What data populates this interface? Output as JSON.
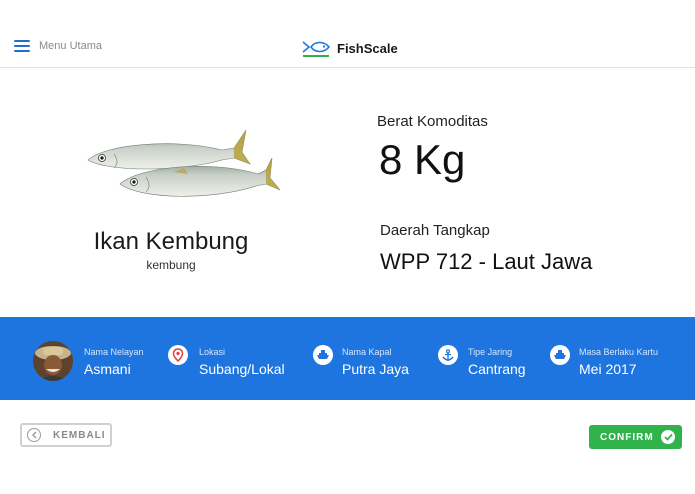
{
  "header": {
    "menu_label": "Menu Utama",
    "brand_name": "FishScale"
  },
  "commodity": {
    "species_name": "Ikan Kembung",
    "species_local_name": "kembung",
    "weight_label": "Berat Komoditas",
    "weight_value": "8 Kg",
    "area_label": "Daerah Tangkap",
    "area_value": "WPP 712 - Laut Jawa"
  },
  "info_bar": {
    "fisherman": {
      "label": "Nama Nelayan",
      "value": "Asmani"
    },
    "location": {
      "label": "Lokasi",
      "value": "Subang/Lokal",
      "icon": "location-pin-icon"
    },
    "vessel": {
      "label": "Nama Kapal",
      "value": "Putra Jaya",
      "icon": "ship-icon"
    },
    "net": {
      "label": "Tipe Jaring",
      "value": "Cantrang",
      "icon": "anchor-icon"
    },
    "card": {
      "label": "Masa Berlaku Kartu",
      "value": "Mei 2017",
      "icon": "ship-icon"
    }
  },
  "actions": {
    "back_label": "KEMBALI",
    "confirm_label": "CONFIRM"
  },
  "colors": {
    "accent_blue": "#1f75e0",
    "confirm_green": "#2fb34a",
    "location_red": "#e0403a"
  }
}
